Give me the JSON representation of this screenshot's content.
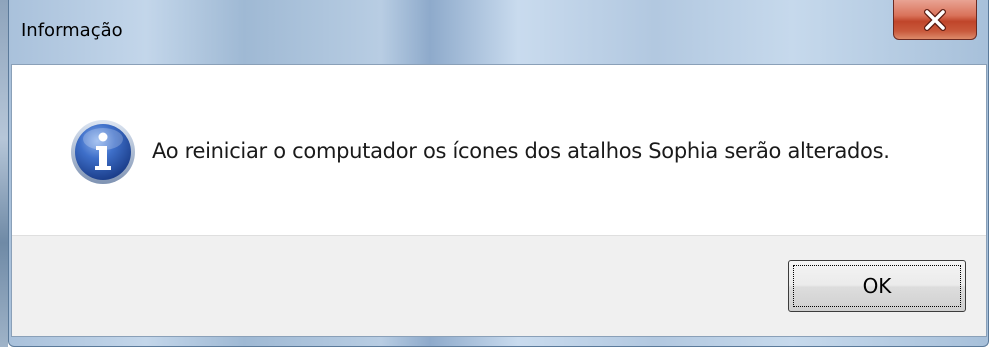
{
  "dialog": {
    "title": "Informação",
    "message": "Ao reiniciar o computador os ícones dos atalhos Sophia serão alterados.",
    "ok_label": "OK",
    "icon": "information-icon",
    "close_icon": "close-icon"
  },
  "colors": {
    "close_button": "#c9452a",
    "info_icon": "#2b5fb5",
    "button_area": "#f0f0f0"
  }
}
